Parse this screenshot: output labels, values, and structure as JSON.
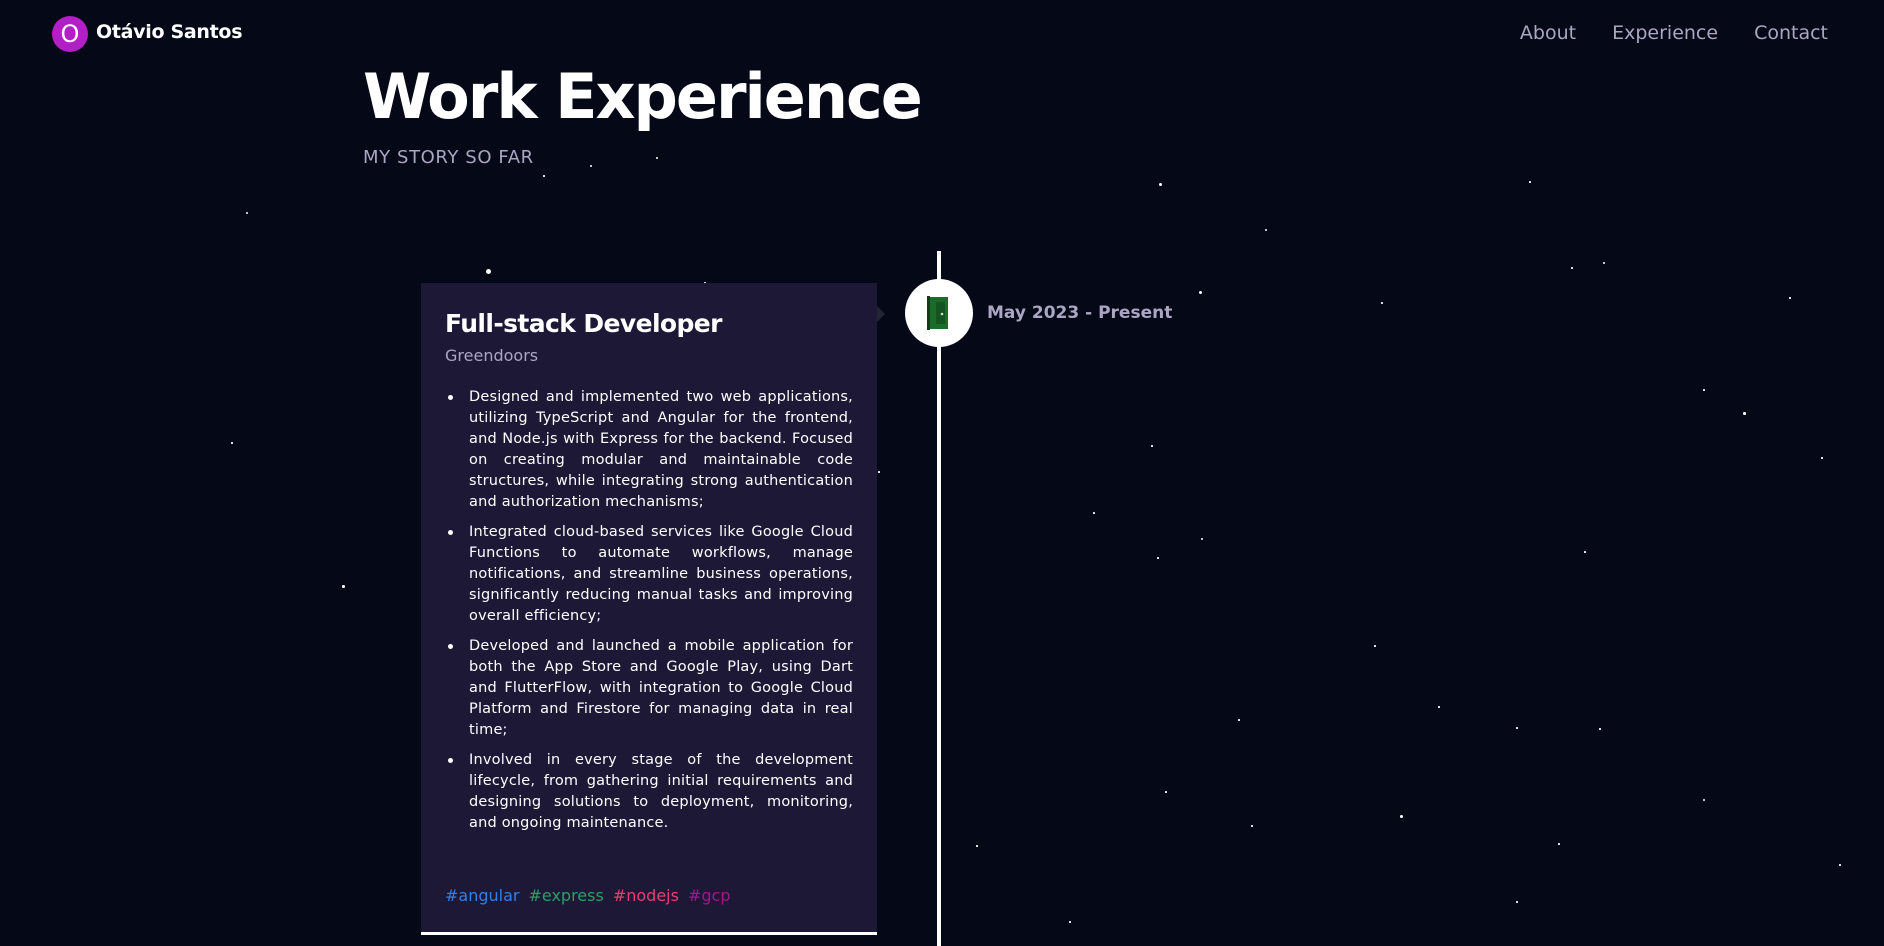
{
  "navbar": {
    "logo_letter": "O",
    "brand_name": "Otávio Santos",
    "links": [
      {
        "label": "About"
      },
      {
        "label": "Experience"
      },
      {
        "label": "Contact"
      }
    ]
  },
  "section": {
    "title": "Work Experience",
    "subtitle": "MY STORY SO FAR"
  },
  "experiences": [
    {
      "title": "Full-stack Developer",
      "company": "Greendoors",
      "date": "May 2023 - Present",
      "icon": "green-door-icon",
      "points": [
        "Designed and implemented two web applications, utilizing TypeScript and Angular for the frontend, and Node.js with Express for the backend. Focused on creating modular and maintainable code structures, while integrating strong authentication and authorization mechanisms;",
        "Integrated cloud-based services like Google Cloud Functions to automate workflows, manage notifications, and streamline business operations, significantly reducing manual tasks and improving overall efficiency;",
        "Developed and launched a mobile application for both the App Store and Google Play, using Dart and FlutterFlow, with integration to Google Cloud Platform and Firestore for managing data in real time;",
        "Involved in every stage of the development lifecycle, from gathering initial requirements and designing solutions to deployment, monitoring, and ongoing maintenance."
      ],
      "tags": [
        {
          "label": "#angular",
          "color": "#2f80ed"
        },
        {
          "label": "#express",
          "color": "#2e9d6b"
        },
        {
          "label": "#nodejs",
          "color": "#ec3d72"
        },
        {
          "label": "#gcp",
          "color": "#a4178a"
        }
      ]
    }
  ],
  "colors": {
    "background": "#050816",
    "card": "#1d1836",
    "secondary_text": "#aaa6c3",
    "logo_accent": "#b21fc7",
    "door_green": "#1b6b2a"
  }
}
